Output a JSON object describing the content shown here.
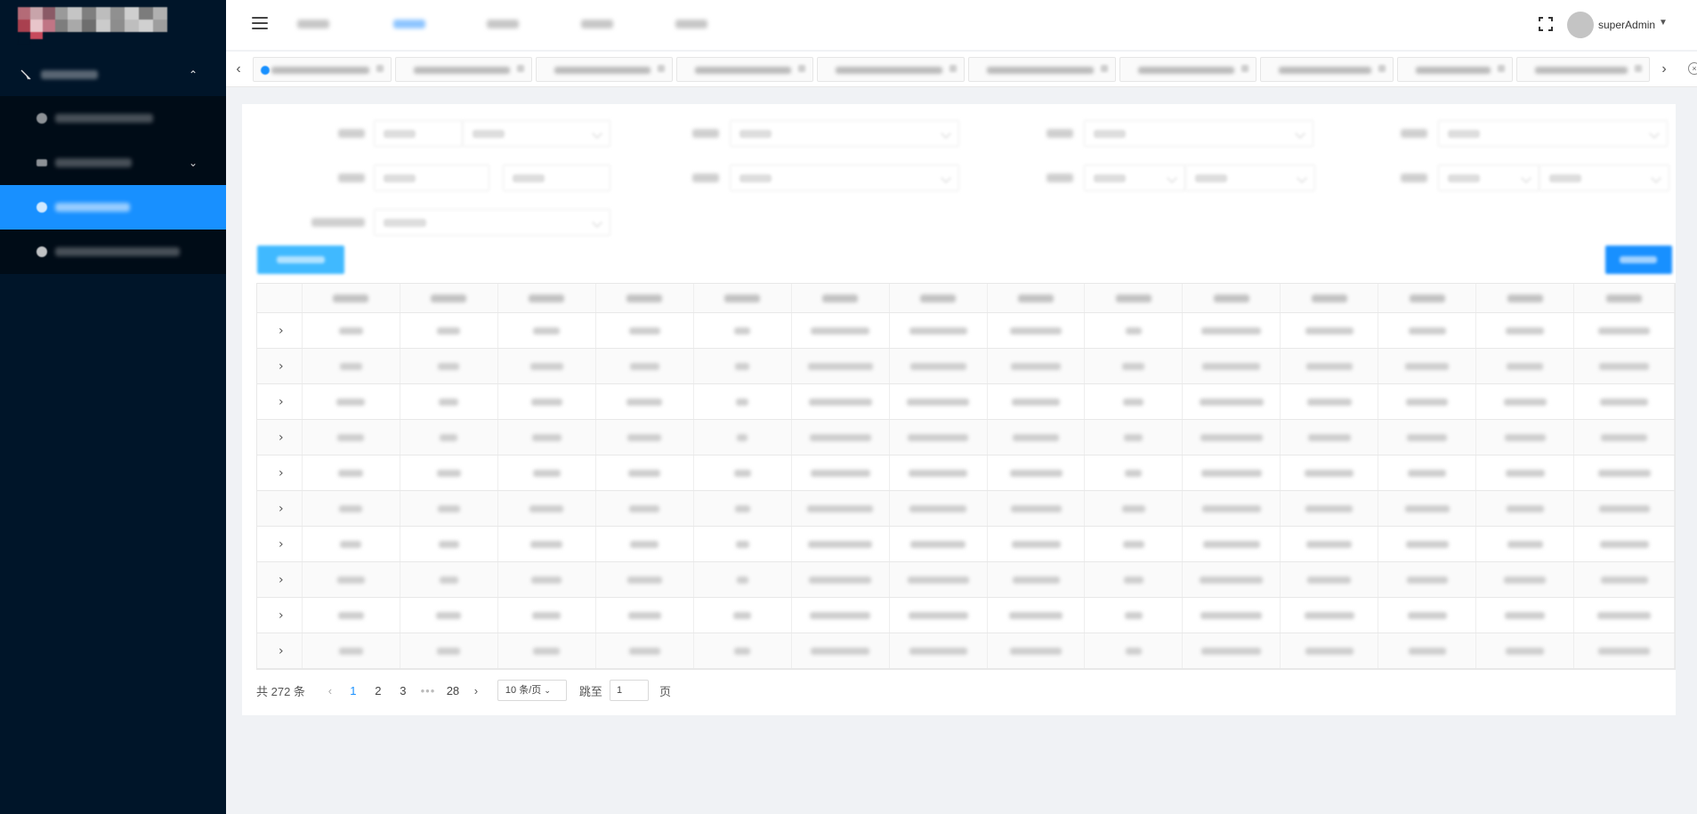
{
  "header": {
    "username": "superAdmin"
  },
  "pagination": {
    "total_label": "共 272 条",
    "pages": [
      "1",
      "2",
      "3",
      "28"
    ],
    "ellipsis": "•••",
    "current_page": "1",
    "page_size_label": "10 条/页",
    "jump_label": "跳至",
    "jump_value": "1",
    "page_suffix": "页"
  },
  "icons": {
    "menu": "hamburger-icon",
    "fullscreen": "fullscreen-icon",
    "prev": "chevron-left-icon",
    "next": "chevron-right-icon",
    "expand": "chevron-right-icon",
    "close_tabs": "close-circle-icon"
  },
  "colors": {
    "sidebar_bg": "#001529",
    "accent": "#1890ff",
    "export_button": "#40b9ff"
  }
}
